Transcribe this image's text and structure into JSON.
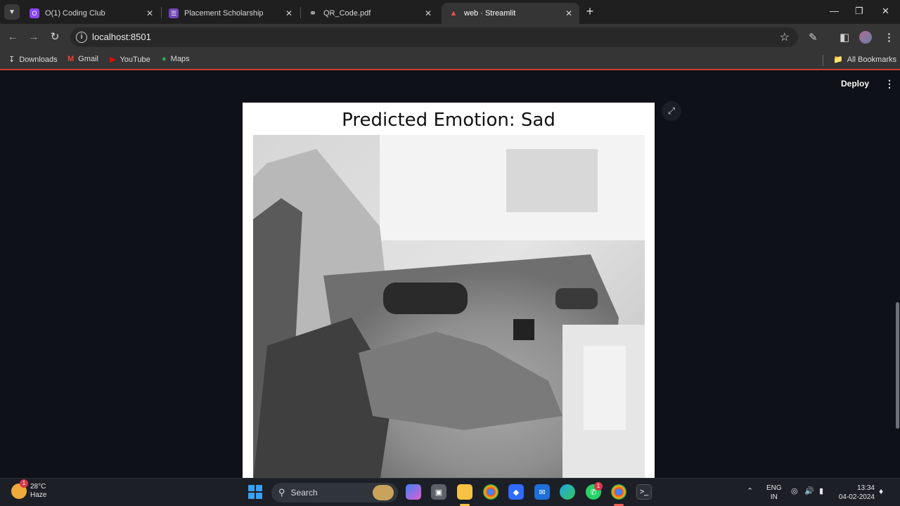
{
  "browser": {
    "tabs": [
      {
        "title": "O(1) Coding Club",
        "icon": "coding-club-icon",
        "color": "#8b44ff"
      },
      {
        "title": "Placement Scholarship",
        "icon": "forms-icon",
        "color": "#7248b9"
      },
      {
        "title": "QR_Code.pdf",
        "icon": "globe-icon",
        "color": "#9aa0a6"
      },
      {
        "title": "web · Streamlit",
        "icon": "streamlit-icon",
        "color": "#ff4b4b",
        "active": true
      }
    ],
    "url": "localhost:8501",
    "bookmarks": [
      {
        "label": "Downloads",
        "icon": "download-icon"
      },
      {
        "label": "Gmail",
        "icon": "gmail-icon"
      },
      {
        "label": "YouTube",
        "icon": "youtube-icon"
      },
      {
        "label": "Maps",
        "icon": "maps-icon"
      }
    ],
    "all_bookmarks": "All Bookmarks"
  },
  "app": {
    "deploy_label": "Deploy",
    "figure_title": "Predicted Emotion: Sad",
    "accent": "#0e1117"
  },
  "taskbar": {
    "weather_temp": "28°C",
    "weather_desc": "Haze",
    "weather_badge": "1",
    "search_label": "Search",
    "whatsapp_badge": "1",
    "lang_top": "ENG",
    "lang_bottom": "IN",
    "time": "13:34",
    "date": "04-02-2024"
  }
}
